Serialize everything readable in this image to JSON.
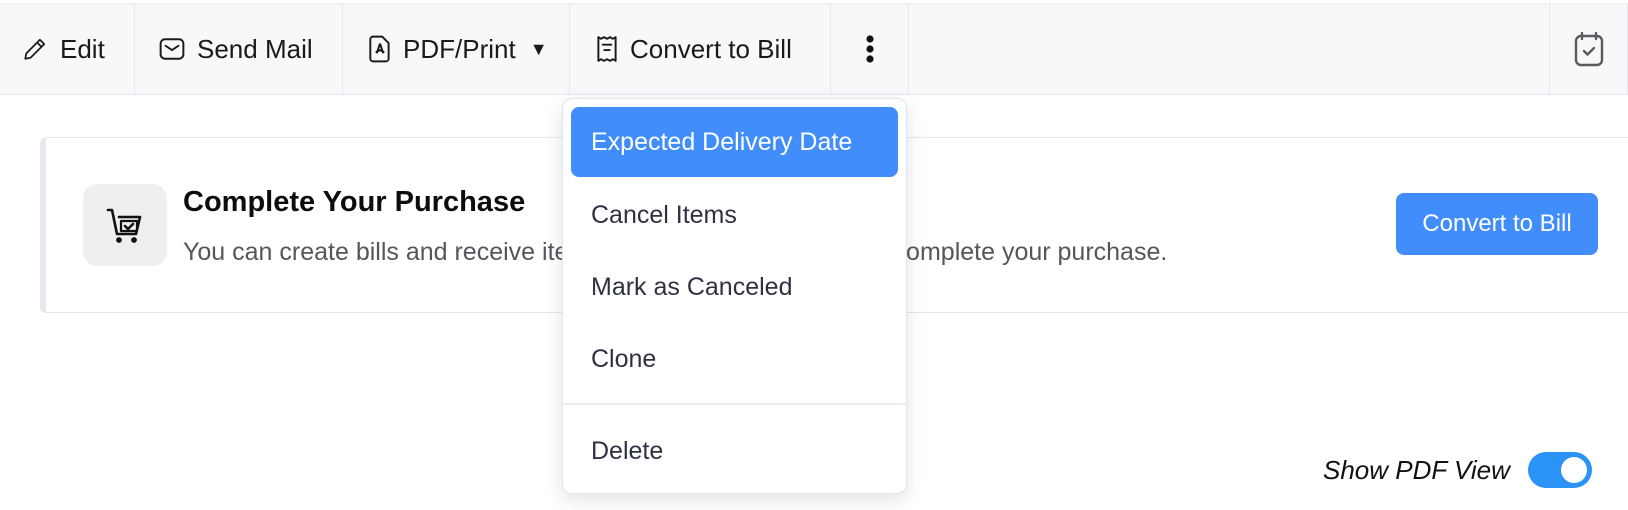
{
  "toolbar": {
    "edit_label": "Edit",
    "send_mail_label": "Send Mail",
    "pdf_print_label": "PDF/Print",
    "pdf_caret": "▼",
    "convert_label": "Convert to Bill",
    "icons": {
      "edit": "pencil-icon",
      "mail": "envelope-icon",
      "pdf": "pdf-file-icon",
      "convert": "receipt-icon",
      "more": "more-vertical-icon",
      "calendar": "calendar-check-icon"
    }
  },
  "dropdown": {
    "items": [
      {
        "label": "Expected Delivery Date",
        "active": true
      },
      {
        "label": "Cancel Items"
      },
      {
        "label": "Mark as Canceled"
      },
      {
        "label": "Clone"
      }
    ],
    "danger_items": [
      {
        "label": "Delete"
      }
    ]
  },
  "card": {
    "title": "Complete Your Purchase",
    "description": "You can create bills and receive items for this purchase order to complete your purchase.",
    "button_label": "Convert to Bill",
    "icon": "cart-check-icon"
  },
  "pdf_view": {
    "label": "Show PDF View",
    "enabled": true
  },
  "colors": {
    "accent": "#408dfb",
    "toggle_on": "#2a93f5",
    "toolbar_bg": "#f8f8fa"
  }
}
